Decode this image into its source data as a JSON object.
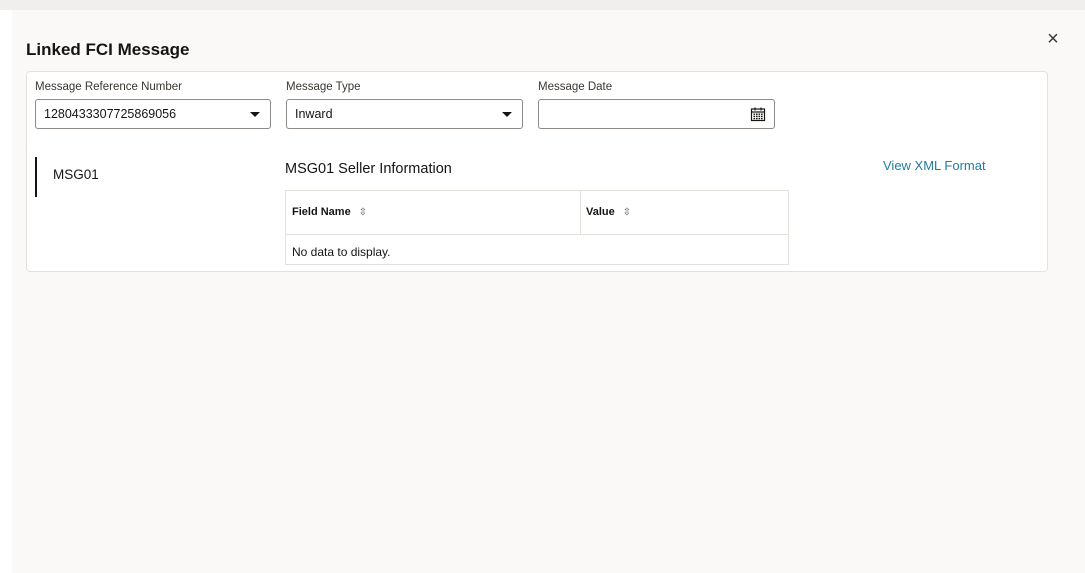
{
  "dialog": {
    "title": "Linked FCI Message",
    "close_glyph": "×"
  },
  "filters": {
    "message_reference_number": {
      "label": "Message Reference Number",
      "value": "1280433307725869056"
    },
    "message_type": {
      "label": "Message Type",
      "value": "Inward"
    },
    "message_date": {
      "label": "Message Date",
      "value": ""
    }
  },
  "messages": {
    "tabs": [
      {
        "label": "MSG01",
        "selected": true
      }
    ]
  },
  "detail": {
    "section_title": "MSG01 Seller Information",
    "view_xml_link": "View XML Format",
    "table": {
      "columns": [
        "Field Name",
        "Value"
      ],
      "sort_glyph": "⇳",
      "empty_message": "No data to display."
    }
  },
  "icons": {
    "close": "close-icon",
    "dropdown": "caret-down-icon",
    "calendar": "calendar-icon",
    "sort": "sort-icon"
  }
}
